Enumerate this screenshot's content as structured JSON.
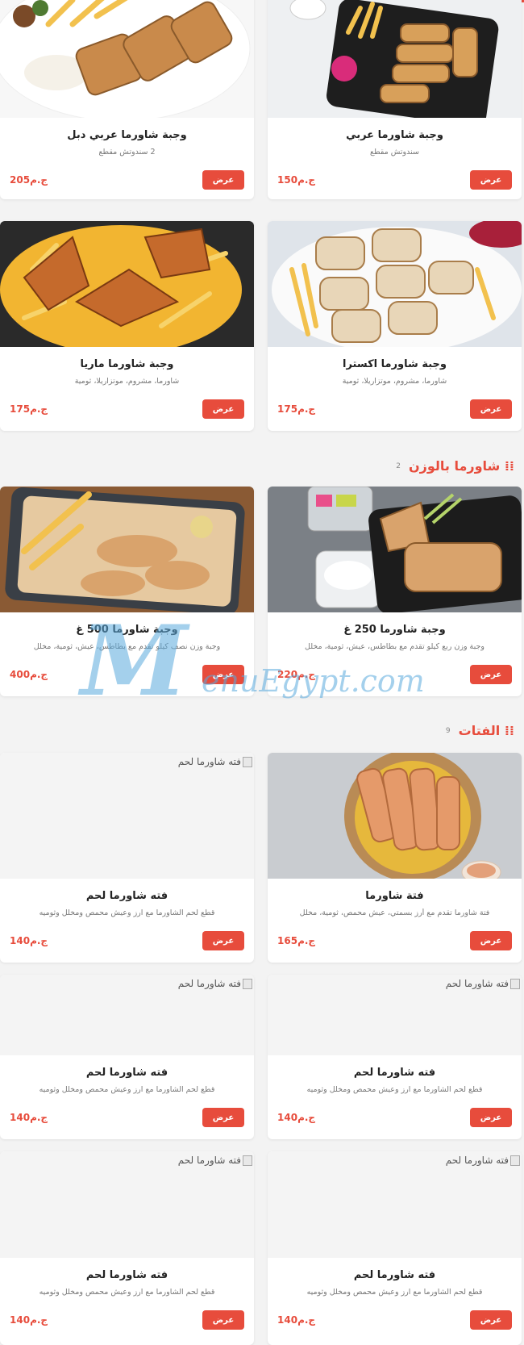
{
  "currency": "ج.م",
  "view_label": "عرض",
  "sections": {
    "weight": {
      "title": "شاورما بالوزن",
      "count": "2"
    },
    "fattah": {
      "title": "الفتات",
      "count": "9"
    }
  },
  "items": [
    {
      "name": "وجبة شاورما عربي دبل",
      "desc": "2 سندوتش مقطع",
      "price": "205ج.م"
    },
    {
      "name": "وجبة شاورما عربي",
      "desc": "سندوتش مقطع",
      "price": "150ج.م"
    },
    {
      "name": "وجبة شاورما ماريا",
      "desc": "شاورما، مشروم، موتزاريلا، ثومية",
      "price": "175ج.م"
    },
    {
      "name": "وجبة شاورما اكسترا",
      "desc": "شاورما، مشروم، موتزاريلا، ثومية",
      "price": "175ج.م"
    },
    {
      "name": "وجبة شاورما 500 غ",
      "desc": "وجبة وزن نصف كيلو تقدم مع بطاطس، عيش، ثومية، مخلل",
      "price": "400ج.م"
    },
    {
      "name": "وجبة شاورما 250 غ",
      "desc": "وجبة وزن ربع كيلو تقدم مع بطاطس، عيش، ثومية، مخلل",
      "price": "220ج.م"
    },
    {
      "name": "فته شاورما لحم",
      "desc": "قطع لحم الشاورما مع ارز وعيش محمص ومخلل وثوميه",
      "price": "140ج.م",
      "alt": "فته شاورما لحم"
    },
    {
      "name": "فتة شاورما",
      "desc": "فتة شاورما تقدم مع أرز بسمتي، عيش محمص، ثومية، مخلل",
      "price": "165ج.م"
    },
    {
      "name": "فته شاورما لحم",
      "desc": "قطع لحم الشاورما مع ارز وعيش محمص ومخلل وثوميه",
      "price": "140ج.م",
      "alt": "فته شاورما لحم"
    },
    {
      "name": "فته شاورما لحم",
      "desc": "قطع لحم الشاورما مع ارز وعيش محمص ومخلل وثوميه",
      "price": "140ج.م",
      "alt": "فته شاورما لحم"
    },
    {
      "name": "فته شاورما لحم",
      "desc": "قطع لحم الشاورما مع ارز وعيش محمص ومخلل وثوميه",
      "price": "140ج.م",
      "alt": "فته شاورما لحم"
    },
    {
      "name": "فته شاورما لحم",
      "desc": "قطع لحم الشاورما مع ارز وعيش محمص ومخلل وثوميه",
      "price": "140ج.م",
      "alt": "فته شاورما لحم"
    }
  ],
  "watermark": {
    "big": "M",
    "rest": "enuEgypt.com"
  },
  "colors": {
    "accent": "#e74c3c",
    "watermark": "#5aaadc"
  }
}
